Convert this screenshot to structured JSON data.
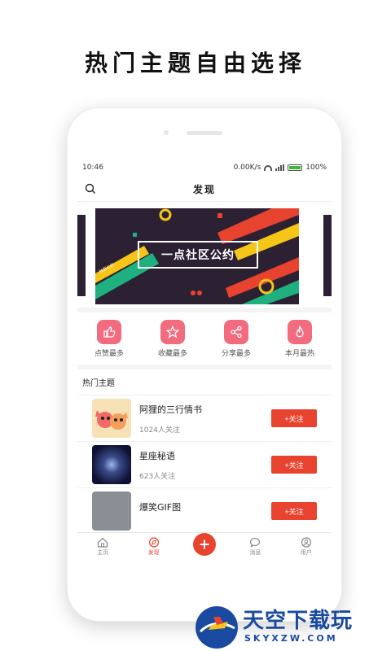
{
  "headline": "热门主题自由选择",
  "status_bar": {
    "time": "10:46",
    "speed": "0.00K/s",
    "battery": "100%"
  },
  "nav": {
    "title": "发现",
    "search_icon": "search-icon"
  },
  "banner": {
    "text": "一点社区公约",
    "corner_text": "社区公约"
  },
  "quick_actions": [
    {
      "label": "点赞最多",
      "icon": "thumbs-up-icon"
    },
    {
      "label": "收藏最多",
      "icon": "star-icon"
    },
    {
      "label": "分享最多",
      "icon": "share-icon"
    },
    {
      "label": "本月最热",
      "icon": "flame-icon"
    }
  ],
  "hot_section": {
    "title": "热门主题",
    "topics": [
      {
        "name": "阿狸的三行情书",
        "followers": "1024人关注",
        "button": "+关注"
      },
      {
        "name": "星座秘语",
        "followers": "623人关注",
        "button": "+关注"
      },
      {
        "name": "爆笑GIF图",
        "followers": "",
        "button": "+关注"
      }
    ]
  },
  "tabs": [
    {
      "label": "主页",
      "icon": "home-icon"
    },
    {
      "label": "发现",
      "icon": "discover-icon",
      "active": true
    },
    {
      "label": "",
      "icon": "plus-icon"
    },
    {
      "label": "消息",
      "icon": "message-icon"
    },
    {
      "label": "用户",
      "icon": "user-icon"
    }
  ],
  "watermark": {
    "main": "天空下载玩",
    "sub": "SKYXZW.COM"
  },
  "colors": {
    "accent": "#e8432f",
    "quick_icon": "#f26b7e",
    "banner_bg": "#2c2133"
  }
}
